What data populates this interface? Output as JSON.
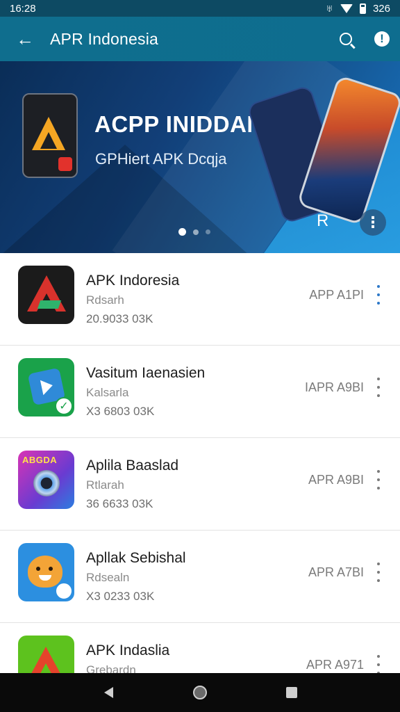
{
  "status_bar": {
    "time": "16:28",
    "battery": "326"
  },
  "app_bar": {
    "title": "APR Indonesia",
    "back_glyph": "←",
    "search_icon": "search-icon",
    "alert_icon": "alert-icon",
    "alert_glyph": "!"
  },
  "banner": {
    "title": "ACPP INIDDANBIA",
    "subtitle": "GPHiert APK Dcqja",
    "glyph": "R",
    "more_glyph": "⋮",
    "page_count": 3,
    "active_page": 1
  },
  "apps": [
    {
      "name": "APK Indoresia",
      "developer": "Rdsarh",
      "size": "20.9033 03K",
      "tag": "APP A1PI",
      "icon": "app-icon-apk-indoresia"
    },
    {
      "name": "Vasitum Iaenasien",
      "developer": "Kalsarla",
      "size": "X3 6803 03K",
      "tag": "IAPR A9BI",
      "icon": "app-icon-vasitum"
    },
    {
      "name": "Aplila Baaslad",
      "developer": "Rtlarah",
      "size": "36 6633 03K",
      "tag": "APR A9BI",
      "icon": "app-icon-aplila"
    },
    {
      "name": "Apllak Sebishal",
      "developer": "Rdsealn",
      "size": "X3 0233 03K",
      "tag": "APR A7BI",
      "icon": "app-icon-apllak"
    },
    {
      "name": "APK Indaslia",
      "developer": "Grebardn",
      "size": "",
      "tag": "APR A971",
      "icon": "app-icon-apk-indaslia"
    }
  ],
  "nav_bar": {
    "back": "nav-back-icon",
    "home": "nav-home-icon",
    "recents": "nav-recents-icon"
  },
  "colors": {
    "app_bar": "#0f6e8e",
    "status_bar": "#0d4a63",
    "accent_blue": "#2d78c8"
  }
}
